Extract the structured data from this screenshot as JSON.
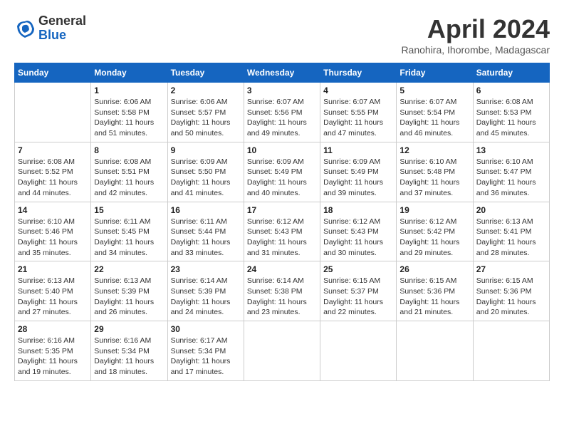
{
  "logo": {
    "general": "General",
    "blue": "Blue"
  },
  "header": {
    "month_title": "April 2024",
    "subtitle": "Ranohira, Ihorombe, Madagascar"
  },
  "weekdays": [
    "Sunday",
    "Monday",
    "Tuesday",
    "Wednesday",
    "Thursday",
    "Friday",
    "Saturday"
  ],
  "weeks": [
    [
      {
        "day": "",
        "info": ""
      },
      {
        "day": "1",
        "info": "Sunrise: 6:06 AM\nSunset: 5:58 PM\nDaylight: 11 hours\nand 51 minutes."
      },
      {
        "day": "2",
        "info": "Sunrise: 6:06 AM\nSunset: 5:57 PM\nDaylight: 11 hours\nand 50 minutes."
      },
      {
        "day": "3",
        "info": "Sunrise: 6:07 AM\nSunset: 5:56 PM\nDaylight: 11 hours\nand 49 minutes."
      },
      {
        "day": "4",
        "info": "Sunrise: 6:07 AM\nSunset: 5:55 PM\nDaylight: 11 hours\nand 47 minutes."
      },
      {
        "day": "5",
        "info": "Sunrise: 6:07 AM\nSunset: 5:54 PM\nDaylight: 11 hours\nand 46 minutes."
      },
      {
        "day": "6",
        "info": "Sunrise: 6:08 AM\nSunset: 5:53 PM\nDaylight: 11 hours\nand 45 minutes."
      }
    ],
    [
      {
        "day": "7",
        "info": "Sunrise: 6:08 AM\nSunset: 5:52 PM\nDaylight: 11 hours\nand 44 minutes."
      },
      {
        "day": "8",
        "info": "Sunrise: 6:08 AM\nSunset: 5:51 PM\nDaylight: 11 hours\nand 42 minutes."
      },
      {
        "day": "9",
        "info": "Sunrise: 6:09 AM\nSunset: 5:50 PM\nDaylight: 11 hours\nand 41 minutes."
      },
      {
        "day": "10",
        "info": "Sunrise: 6:09 AM\nSunset: 5:49 PM\nDaylight: 11 hours\nand 40 minutes."
      },
      {
        "day": "11",
        "info": "Sunrise: 6:09 AM\nSunset: 5:49 PM\nDaylight: 11 hours\nand 39 minutes."
      },
      {
        "day": "12",
        "info": "Sunrise: 6:10 AM\nSunset: 5:48 PM\nDaylight: 11 hours\nand 37 minutes."
      },
      {
        "day": "13",
        "info": "Sunrise: 6:10 AM\nSunset: 5:47 PM\nDaylight: 11 hours\nand 36 minutes."
      }
    ],
    [
      {
        "day": "14",
        "info": "Sunrise: 6:10 AM\nSunset: 5:46 PM\nDaylight: 11 hours\nand 35 minutes."
      },
      {
        "day": "15",
        "info": "Sunrise: 6:11 AM\nSunset: 5:45 PM\nDaylight: 11 hours\nand 34 minutes."
      },
      {
        "day": "16",
        "info": "Sunrise: 6:11 AM\nSunset: 5:44 PM\nDaylight: 11 hours\nand 33 minutes."
      },
      {
        "day": "17",
        "info": "Sunrise: 6:12 AM\nSunset: 5:43 PM\nDaylight: 11 hours\nand 31 minutes."
      },
      {
        "day": "18",
        "info": "Sunrise: 6:12 AM\nSunset: 5:43 PM\nDaylight: 11 hours\nand 30 minutes."
      },
      {
        "day": "19",
        "info": "Sunrise: 6:12 AM\nSunset: 5:42 PM\nDaylight: 11 hours\nand 29 minutes."
      },
      {
        "day": "20",
        "info": "Sunrise: 6:13 AM\nSunset: 5:41 PM\nDaylight: 11 hours\nand 28 minutes."
      }
    ],
    [
      {
        "day": "21",
        "info": "Sunrise: 6:13 AM\nSunset: 5:40 PM\nDaylight: 11 hours\nand 27 minutes."
      },
      {
        "day": "22",
        "info": "Sunrise: 6:13 AM\nSunset: 5:39 PM\nDaylight: 11 hours\nand 26 minutes."
      },
      {
        "day": "23",
        "info": "Sunrise: 6:14 AM\nSunset: 5:39 PM\nDaylight: 11 hours\nand 24 minutes."
      },
      {
        "day": "24",
        "info": "Sunrise: 6:14 AM\nSunset: 5:38 PM\nDaylight: 11 hours\nand 23 minutes."
      },
      {
        "day": "25",
        "info": "Sunrise: 6:15 AM\nSunset: 5:37 PM\nDaylight: 11 hours\nand 22 minutes."
      },
      {
        "day": "26",
        "info": "Sunrise: 6:15 AM\nSunset: 5:36 PM\nDaylight: 11 hours\nand 21 minutes."
      },
      {
        "day": "27",
        "info": "Sunrise: 6:15 AM\nSunset: 5:36 PM\nDaylight: 11 hours\nand 20 minutes."
      }
    ],
    [
      {
        "day": "28",
        "info": "Sunrise: 6:16 AM\nSunset: 5:35 PM\nDaylight: 11 hours\nand 19 minutes."
      },
      {
        "day": "29",
        "info": "Sunrise: 6:16 AM\nSunset: 5:34 PM\nDaylight: 11 hours\nand 18 minutes."
      },
      {
        "day": "30",
        "info": "Sunrise: 6:17 AM\nSunset: 5:34 PM\nDaylight: 11 hours\nand 17 minutes."
      },
      {
        "day": "",
        "info": ""
      },
      {
        "day": "",
        "info": ""
      },
      {
        "day": "",
        "info": ""
      },
      {
        "day": "",
        "info": ""
      }
    ]
  ]
}
